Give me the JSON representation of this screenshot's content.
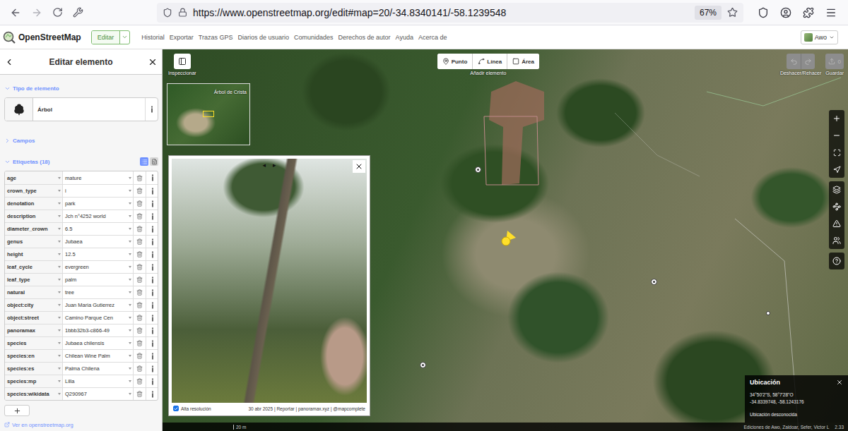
{
  "browser": {
    "url": "https://www.openstreetmap.org/edit#map=20/-34.8340141/-58.1239548",
    "zoom": "67%"
  },
  "header": {
    "brand": "OpenStreetMap",
    "edit": "Editar",
    "nav": [
      "Historial",
      "Exportar",
      "Trazas GPS",
      "Diarios de usuario",
      "Comunidades",
      "Derechos de autor",
      "Ayuda",
      "Acerca de"
    ],
    "user": "Awo"
  },
  "map_toolbar": {
    "inspect": "Inspeccionar",
    "add_label": "Añadir elemento",
    "modes": [
      {
        "label": "Punto",
        "selected": false
      },
      {
        "label": "Línea",
        "selected": false
      },
      {
        "label": "Área",
        "selected": false
      }
    ],
    "undo_label": "Deshacer/Rehacer",
    "undo_disabled": true,
    "redo_disabled": true,
    "save_label": "Guardar",
    "save_count": "0",
    "save_disabled": true
  },
  "sidebar": {
    "title": "Editar elemento",
    "sections": {
      "type": {
        "label": "Tipo de elemento",
        "expanded": true
      },
      "fields": {
        "label": "Campos",
        "expanded": false
      },
      "tags": {
        "label": "Etiquetas (18)",
        "expanded": true
      }
    },
    "preset": "Árbol",
    "tag_view": [
      {
        "kind": "list",
        "selected": true
      },
      {
        "kind": "text",
        "selected": false
      }
    ],
    "tags": [
      {
        "key": "age",
        "value": "mature"
      },
      {
        "key": "crown_type",
        "value": "i"
      },
      {
        "key": "denotation",
        "value": "park"
      },
      {
        "key": "description",
        "value": "Jch n°4252 world"
      },
      {
        "key": "diameter_crown",
        "value": "6.5"
      },
      {
        "key": "genus",
        "value": "Jubaea"
      },
      {
        "key": "height",
        "value": "12.5"
      },
      {
        "key": "leaf_cycle",
        "value": "evergreen"
      },
      {
        "key": "leaf_type",
        "value": "palm"
      },
      {
        "key": "natural",
        "value": "tree"
      },
      {
        "key": "object:city",
        "value": "Juan Maria Gutierrez"
      },
      {
        "key": "object:street",
        "value": "Camino Parque Cen"
      },
      {
        "key": "panoramax",
        "value": "1bbb32b3-c866-49"
      },
      {
        "key": "species",
        "value": "Jubaea chilensis"
      },
      {
        "key": "species:en",
        "value": "Chilean Wine Palm"
      },
      {
        "key": "species:es",
        "value": "Palma Chilena"
      },
      {
        "key": "species:mp",
        "value": "Lilla"
      },
      {
        "key": "species:wikidata",
        "value": "Q290967"
      }
    ],
    "footer_link": "Ver en openstreetmap.org"
  },
  "minimap": {
    "label": "Árbol de Crista"
  },
  "viewer": {
    "prev": "◂",
    "next": "▸",
    "hires_label": "Alta resolución",
    "hires_checked": true,
    "credits": "30 abr 2025 | Reportar | panoramax.xyz | @mapcomplete"
  },
  "features": [
    {
      "kind": "point",
      "selected": false
    },
    {
      "kind": "point",
      "selected": false
    },
    {
      "kind": "point",
      "selected": false
    },
    {
      "kind": "vertex",
      "selected": false
    },
    {
      "kind": "point",
      "selected": true
    }
  ],
  "location": {
    "title": "Ubicación",
    "dms": "34°50'2\"S, 58°7'28\"O",
    "decimal": "-34.8339748, -58.1243176",
    "address": "Ubicación desconocida"
  },
  "footer": {
    "scale": "20 m",
    "attribution": "Ediciones de Awo, Zaldoar, Sefer, Victor L",
    "version": "2.33"
  }
}
